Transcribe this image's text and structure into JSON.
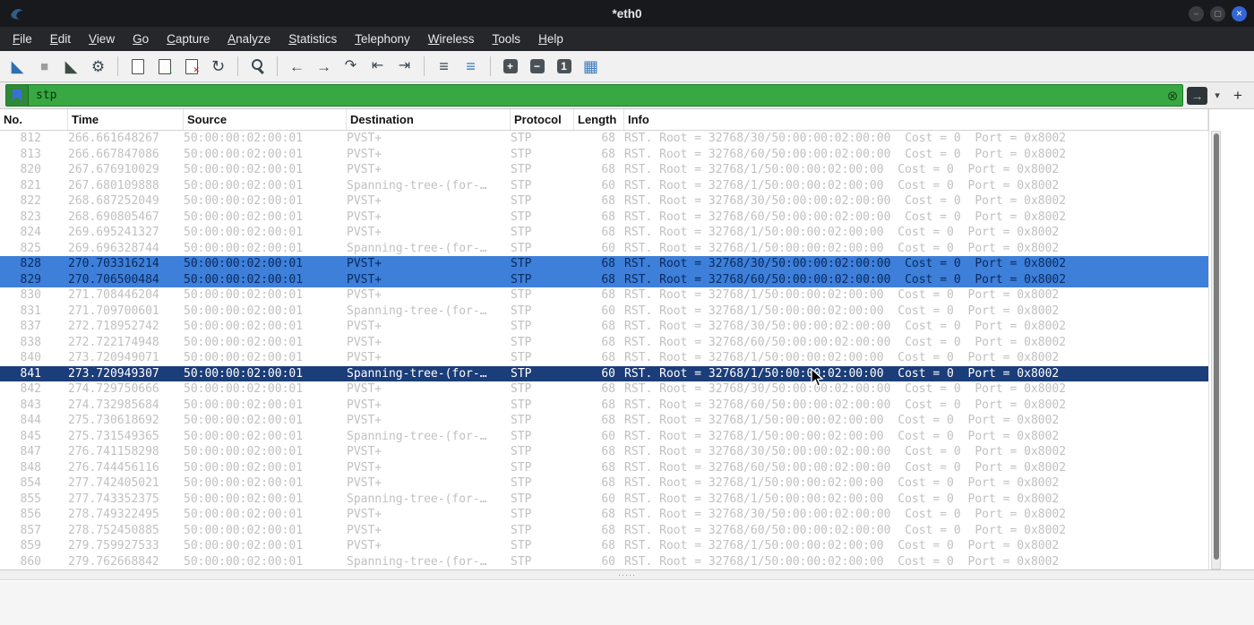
{
  "window": {
    "title": "*eth0"
  },
  "colors": {
    "titlebar_bg": "#17191d",
    "menubar_bg": "#26272b",
    "close_button": "#3566d6",
    "accent_blue": "#2e6fb2",
    "filter_valid": "#38a843",
    "row_dim_text": "#c1c1c1",
    "row_highlight_bg": "#3d7fd9",
    "row_highlight_text": "#0a2a5e",
    "row_selected_bg": "#1b3d79",
    "row_selected_text": "#ffffff"
  },
  "menu": {
    "items": [
      "File",
      "Edit",
      "View",
      "Go",
      "Capture",
      "Analyze",
      "Statistics",
      "Telephony",
      "Wireless",
      "Tools",
      "Help"
    ]
  },
  "toolbar": {
    "groups": [
      [
        "start-capture",
        "stop-capture",
        "restart-capture",
        "capture-options"
      ],
      [
        "open-file",
        "save-file",
        "close-file",
        "reload"
      ],
      [
        "find-packet"
      ],
      [
        "go-back",
        "go-forward",
        "go-to-packet",
        "previous-packet",
        "next-packet"
      ],
      [
        "auto-scroll",
        "colorize"
      ],
      [
        "zoom-in",
        "zoom-out",
        "zoom-original",
        "resize-columns"
      ]
    ]
  },
  "filter": {
    "value": "stp"
  },
  "splitter": {
    "dots": "·····"
  },
  "packets": {
    "columns": [
      "No.",
      "Time",
      "Source",
      "Destination",
      "Protocol",
      "Length",
      "Info"
    ],
    "rows": [
      {
        "no": "812",
        "time": "266.661648267",
        "source": "50:00:00:02:00:01",
        "destination": "PVST+",
        "protocol": "STP",
        "length": "68",
        "info": "RST. Root = 32768/30/50:00:00:02:00:00  Cost = 0  Port = 0x8002",
        "state": "dim"
      },
      {
        "no": "813",
        "time": "266.667847086",
        "source": "50:00:00:02:00:01",
        "destination": "PVST+",
        "protocol": "STP",
        "length": "68",
        "info": "RST. Root = 32768/60/50:00:00:02:00:00  Cost = 0  Port = 0x8002",
        "state": "dim"
      },
      {
        "no": "820",
        "time": "267.676910029",
        "source": "50:00:00:02:00:01",
        "destination": "PVST+",
        "protocol": "STP",
        "length": "68",
        "info": "RST. Root = 32768/1/50:00:00:02:00:00  Cost = 0  Port = 0x8002",
        "state": "dim"
      },
      {
        "no": "821",
        "time": "267.680109888",
        "source": "50:00:00:02:00:01",
        "destination": "Spanning-tree-(for-…",
        "protocol": "STP",
        "length": "60",
        "info": "RST. Root = 32768/1/50:00:00:02:00:00  Cost = 0  Port = 0x8002",
        "state": "dim"
      },
      {
        "no": "822",
        "time": "268.687252049",
        "source": "50:00:00:02:00:01",
        "destination": "PVST+",
        "protocol": "STP",
        "length": "68",
        "info": "RST. Root = 32768/30/50:00:00:02:00:00  Cost = 0  Port = 0x8002",
        "state": "dim"
      },
      {
        "no": "823",
        "time": "268.690805467",
        "source": "50:00:00:02:00:01",
        "destination": "PVST+",
        "protocol": "STP",
        "length": "68",
        "info": "RST. Root = 32768/60/50:00:00:02:00:00  Cost = 0  Port = 0x8002",
        "state": "dim"
      },
      {
        "no": "824",
        "time": "269.695241327",
        "source": "50:00:00:02:00:01",
        "destination": "PVST+",
        "protocol": "STP",
        "length": "68",
        "info": "RST. Root = 32768/1/50:00:00:02:00:00  Cost = 0  Port = 0x8002",
        "state": "dim"
      },
      {
        "no": "825",
        "time": "269.696328744",
        "source": "50:00:00:02:00:01",
        "destination": "Spanning-tree-(for-…",
        "protocol": "STP",
        "length": "60",
        "info": "RST. Root = 32768/1/50:00:00:02:00:00  Cost = 0  Port = 0x8002",
        "state": "dim"
      },
      {
        "no": "828",
        "time": "270.703316214",
        "source": "50:00:00:02:00:01",
        "destination": "PVST+",
        "protocol": "STP",
        "length": "68",
        "info": "RST. Root = 32768/30/50:00:00:02:00:00  Cost = 0  Port = 0x8002",
        "state": "highlight"
      },
      {
        "no": "829",
        "time": "270.706500484",
        "source": "50:00:00:02:00:01",
        "destination": "PVST+",
        "protocol": "STP",
        "length": "68",
        "info": "RST. Root = 32768/60/50:00:00:02:00:00  Cost = 0  Port = 0x8002",
        "state": "highlight"
      },
      {
        "no": "830",
        "time": "271.708446204",
        "source": "50:00:00:02:00:01",
        "destination": "PVST+",
        "protocol": "STP",
        "length": "68",
        "info": "RST. Root = 32768/1/50:00:00:02:00:00  Cost = 0  Port = 0x8002",
        "state": "dim"
      },
      {
        "no": "831",
        "time": "271.709700601",
        "source": "50:00:00:02:00:01",
        "destination": "Spanning-tree-(for-…",
        "protocol": "STP",
        "length": "60",
        "info": "RST. Root = 32768/1/50:00:00:02:00:00  Cost = 0  Port = 0x8002",
        "state": "dim"
      },
      {
        "no": "837",
        "time": "272.718952742",
        "source": "50:00:00:02:00:01",
        "destination": "PVST+",
        "protocol": "STP",
        "length": "68",
        "info": "RST. Root = 32768/30/50:00:00:02:00:00  Cost = 0  Port = 0x8002",
        "state": "dim"
      },
      {
        "no": "838",
        "time": "272.722174948",
        "source": "50:00:00:02:00:01",
        "destination": "PVST+",
        "protocol": "STP",
        "length": "68",
        "info": "RST. Root = 32768/60/50:00:00:02:00:00  Cost = 0  Port = 0x8002",
        "state": "dim"
      },
      {
        "no": "840",
        "time": "273.720949071",
        "source": "50:00:00:02:00:01",
        "destination": "PVST+",
        "protocol": "STP",
        "length": "68",
        "info": "RST. Root = 32768/1/50:00:00:02:00:00  Cost = 0  Port = 0x8002",
        "state": "dim"
      },
      {
        "no": "841",
        "time": "273.720949307",
        "source": "50:00:00:02:00:01",
        "destination": "Spanning-tree-(for-…",
        "protocol": "STP",
        "length": "60",
        "info": "RST. Root = 32768/1/50:00:00:02:00:00  Cost = 0  Port = 0x8002",
        "state": "selected"
      },
      {
        "no": "842",
        "time": "274.729750666",
        "source": "50:00:00:02:00:01",
        "destination": "PVST+",
        "protocol": "STP",
        "length": "68",
        "info": "RST. Root = 32768/30/50:00:00:02:00:00  Cost = 0  Port = 0x8002",
        "state": "dim"
      },
      {
        "no": "843",
        "time": "274.732985684",
        "source": "50:00:00:02:00:01",
        "destination": "PVST+",
        "protocol": "STP",
        "length": "68",
        "info": "RST. Root = 32768/60/50:00:00:02:00:00  Cost = 0  Port = 0x8002",
        "state": "dim"
      },
      {
        "no": "844",
        "time": "275.730618692",
        "source": "50:00:00:02:00:01",
        "destination": "PVST+",
        "protocol": "STP",
        "length": "68",
        "info": "RST. Root = 32768/1/50:00:00:02:00:00  Cost = 0  Port = 0x8002",
        "state": "dim"
      },
      {
        "no": "845",
        "time": "275.731549365",
        "source": "50:00:00:02:00:01",
        "destination": "Spanning-tree-(for-…",
        "protocol": "STP",
        "length": "60",
        "info": "RST. Root = 32768/1/50:00:00:02:00:00  Cost = 0  Port = 0x8002",
        "state": "dim"
      },
      {
        "no": "847",
        "time": "276.741158298",
        "source": "50:00:00:02:00:01",
        "destination": "PVST+",
        "protocol": "STP",
        "length": "68",
        "info": "RST. Root = 32768/30/50:00:00:02:00:00  Cost = 0  Port = 0x8002",
        "state": "dim"
      },
      {
        "no": "848",
        "time": "276.744456116",
        "source": "50:00:00:02:00:01",
        "destination": "PVST+",
        "protocol": "STP",
        "length": "68",
        "info": "RST. Root = 32768/60/50:00:00:02:00:00  Cost = 0  Port = 0x8002",
        "state": "dim"
      },
      {
        "no": "854",
        "time": "277.742405021",
        "source": "50:00:00:02:00:01",
        "destination": "PVST+",
        "protocol": "STP",
        "length": "68",
        "info": "RST. Root = 32768/1/50:00:00:02:00:00  Cost = 0  Port = 0x8002",
        "state": "dim"
      },
      {
        "no": "855",
        "time": "277.743352375",
        "source": "50:00:00:02:00:01",
        "destination": "Spanning-tree-(for-…",
        "protocol": "STP",
        "length": "60",
        "info": "RST. Root = 32768/1/50:00:00:02:00:00  Cost = 0  Port = 0x8002",
        "state": "dim"
      },
      {
        "no": "856",
        "time": "278.749322495",
        "source": "50:00:00:02:00:01",
        "destination": "PVST+",
        "protocol": "STP",
        "length": "68",
        "info": "RST. Root = 32768/30/50:00:00:02:00:00  Cost = 0  Port = 0x8002",
        "state": "dim"
      },
      {
        "no": "857",
        "time": "278.752450885",
        "source": "50:00:00:02:00:01",
        "destination": "PVST+",
        "protocol": "STP",
        "length": "68",
        "info": "RST. Root = 32768/60/50:00:00:02:00:00  Cost = 0  Port = 0x8002",
        "state": "dim"
      },
      {
        "no": "859",
        "time": "279.759927533",
        "source": "50:00:00:02:00:01",
        "destination": "PVST+",
        "protocol": "STP",
        "length": "68",
        "info": "RST. Root = 32768/1/50:00:00:02:00:00  Cost = 0  Port = 0x8002",
        "state": "dim"
      },
      {
        "no": "860",
        "time": "279.762668842",
        "source": "50:00:00:02:00:01",
        "destination": "Spanning-tree-(for-…",
        "protocol": "STP",
        "length": "60",
        "info": "RST. Root = 32768/1/50:00:00:02:00:00  Cost = 0  Port = 0x8002",
        "state": "dim"
      }
    ]
  }
}
